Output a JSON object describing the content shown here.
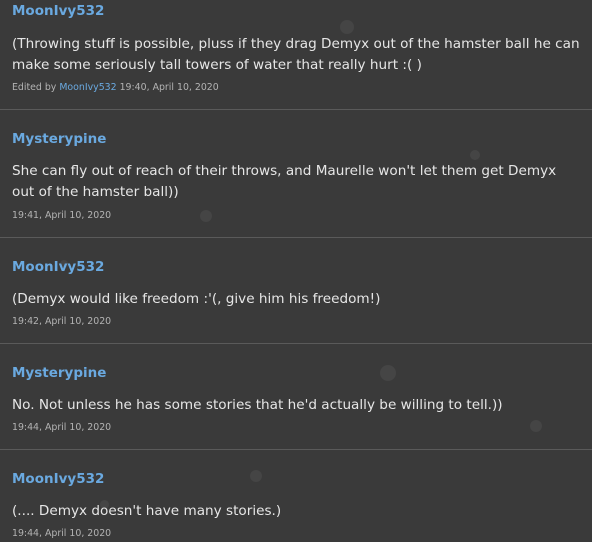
{
  "posts": [
    {
      "author": "MoonIvy532",
      "text": "(Throwing stuff is possible, pluss if they drag Demyx out of the hamster ball he can make some seriously tall towers of water that really hurt :( )",
      "edited_prefix": "Edited by ",
      "edited_by": "MoonIvy532",
      "time": "19:40, April 10, 2020"
    },
    {
      "author": "Mysterypine",
      "text": "She can fly out of reach of their throws, and Maurelle won't let them get Demyx out of the hamster ball))",
      "time": "19:41, April 10, 2020"
    },
    {
      "author": "MoonIvy532",
      "text": "(Demyx would like freedom :'(, give him his freedom!)",
      "time": "19:42, April 10, 2020"
    },
    {
      "author": "Mysterypine",
      "text": "No. Not unless he has some stories that he'd actually be willing to tell.))",
      "time": "19:44, April 10, 2020"
    },
    {
      "author": "MoonIvy532",
      "text": "(.... Demyx doesn't have many stories.)",
      "time": "19:44, April 10, 2020"
    }
  ]
}
